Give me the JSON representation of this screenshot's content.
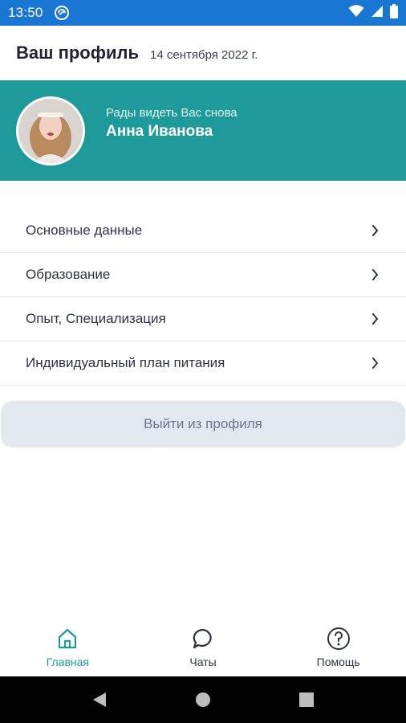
{
  "status_bar": {
    "time": "13:50",
    "app_icon": "sync-circle-icon",
    "icons": [
      "wifi-icon",
      "signal-icon",
      "battery-icon"
    ],
    "background": "#1976d2"
  },
  "header": {
    "title": "Ваш профиль",
    "date": "14 сентября 2022 г."
  },
  "profile": {
    "greeting": "Рады видеть Вас снова",
    "name": "Анна Иванова",
    "avatar_icon": "user-avatar",
    "banner_color": "#1e9a9b"
  },
  "menu": {
    "items": [
      {
        "label": "Основные данные"
      },
      {
        "label": "Образование"
      },
      {
        "label": "Опыт, Специализация"
      },
      {
        "label": "Индивидуальный план питания"
      }
    ],
    "chevron_icon": "chevron-right-icon"
  },
  "logout": {
    "label": "Выйти из профиля"
  },
  "bottom_nav": {
    "tabs": [
      {
        "label": "Главная",
        "icon": "home-icon",
        "active": true
      },
      {
        "label": "Чаты",
        "icon": "chat-icon",
        "active": false
      },
      {
        "label": "Помощь",
        "icon": "help-icon",
        "active": false
      }
    ],
    "accent": "#1e9a9b"
  },
  "system_nav": {
    "buttons": [
      "back-icon",
      "home-circle-icon",
      "recents-icon"
    ]
  }
}
